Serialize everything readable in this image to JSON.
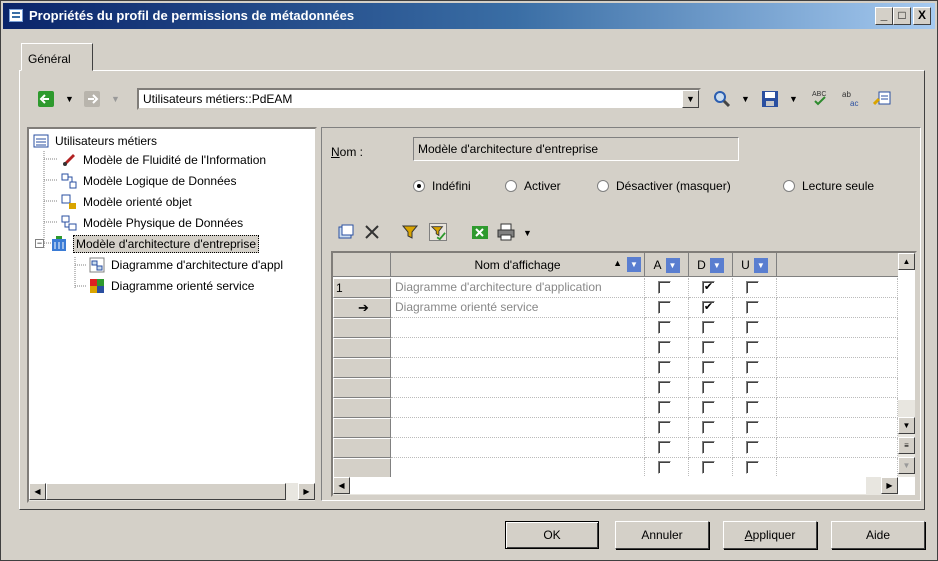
{
  "window": {
    "title": "Propriétés du profil de permissions de métadonnées",
    "min": "_",
    "max": "□",
    "close": "X"
  },
  "tabs": {
    "general": "Général"
  },
  "toolbar": {
    "location": "Utilisateurs métiers::PdEAM"
  },
  "tree": {
    "root": "Utilisateurs métiers",
    "items": [
      "Modèle de Fluidité de l'Information",
      "Modèle Logique de Données",
      "Modèle orienté objet",
      "Modèle Physique de Données",
      "Modèle d'architecture d'entreprise",
      "Diagramme d'architecture d'appl",
      "Diagramme orienté service"
    ],
    "expander": "−"
  },
  "form": {
    "name_label_first": "N",
    "name_label_rest": "om :",
    "name_value": "Modèle d'architecture d'entreprise",
    "radios": [
      "Indéfini",
      "Activer",
      "Désactiver (masquer)",
      "Lecture seule"
    ],
    "selected_radio": 0
  },
  "grid": {
    "columns": [
      "Nom d'affichage",
      "A",
      "D",
      "U"
    ],
    "sort_indicator": "▲",
    "rows": [
      {
        "marker": "1",
        "name": "Diagramme d'architecture d'application",
        "A": false,
        "D": true,
        "U": false
      },
      {
        "marker": "➔",
        "name": "Diagramme orienté service",
        "A": false,
        "D": true,
        "U": false
      },
      {
        "marker": "",
        "name": "",
        "A": false,
        "D": false,
        "U": false
      },
      {
        "marker": "",
        "name": "",
        "A": false,
        "D": false,
        "U": false
      },
      {
        "marker": "",
        "name": "",
        "A": false,
        "D": false,
        "U": false
      },
      {
        "marker": "",
        "name": "",
        "A": false,
        "D": false,
        "U": false
      },
      {
        "marker": "",
        "name": "",
        "A": false,
        "D": false,
        "U": false
      },
      {
        "marker": "",
        "name": "",
        "A": false,
        "D": false,
        "U": false
      },
      {
        "marker": "",
        "name": "",
        "A": false,
        "D": false,
        "U": false
      },
      {
        "marker": "",
        "name": "",
        "A": false,
        "D": false,
        "U": false
      }
    ]
  },
  "buttons": {
    "ok": "OK",
    "cancel": "Annuler",
    "apply_first": "A",
    "apply_rest": "ppliquer",
    "help": "Aide"
  },
  "colors": {
    "accent": "#0a246a",
    "face": "#d4d0c8"
  }
}
